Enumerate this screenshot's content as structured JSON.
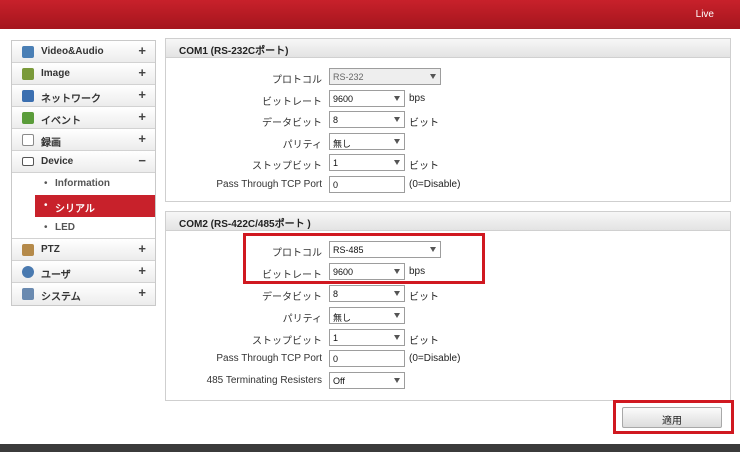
{
  "header": {
    "status_label": "Live"
  },
  "sidebar": {
    "items": [
      {
        "label": "Video&Audio",
        "toggle": "+",
        "icon": "video-audio-icon",
        "color": "#4a7fb5"
      },
      {
        "label": "Image",
        "toggle": "+",
        "icon": "image-icon",
        "color": "#7a9a3a"
      },
      {
        "label": "ネットワーク",
        "toggle": "+",
        "icon": "network-icon",
        "color": "#3b6fb0"
      },
      {
        "label": "イベント",
        "toggle": "+",
        "icon": "event-icon",
        "color": "#5a9c3a"
      },
      {
        "label": "録画",
        "toggle": "+",
        "icon": "recording-icon",
        "color": "#8a8a8a"
      },
      {
        "label": "Device",
        "toggle": "−",
        "icon": "device-icon",
        "color": "#555555"
      },
      {
        "label": "PTZ",
        "toggle": "+",
        "icon": "ptz-icon",
        "color": "#b58a4a"
      },
      {
        "label": "ユーザ",
        "toggle": "+",
        "icon": "user-icon",
        "color": "#4a7ab0"
      },
      {
        "label": "システム",
        "toggle": "+",
        "icon": "system-icon",
        "color": "#6a8ab0"
      }
    ],
    "device_sub": [
      {
        "label": "Information",
        "bullet": "•"
      },
      {
        "label": "シリアル",
        "bullet": "•"
      },
      {
        "label": "LED",
        "bullet": "•"
      }
    ]
  },
  "com1": {
    "title": "COM1 (RS-232Cポート)",
    "protocol": {
      "label": "プロトコル",
      "value": "RS-232"
    },
    "bitrate": {
      "label": "ビットレート",
      "value": "9600",
      "unit": "bps"
    },
    "databits": {
      "label": "データビット",
      "value": "8",
      "unit": "ビット"
    },
    "parity": {
      "label": "パリティ",
      "value": "無し"
    },
    "stopbits": {
      "label": "ストップビット",
      "value": "1",
      "unit": "ビット"
    },
    "tcp_port": {
      "label": "Pass Through TCP Port",
      "value": "0",
      "unit": "(0=Disable)"
    }
  },
  "com2": {
    "title": "COM2 (RS-422C/485ポート )",
    "protocol": {
      "label": "プロトコル",
      "value": "RS-485"
    },
    "bitrate": {
      "label": "ビットレート",
      "value": "9600",
      "unit": "bps"
    },
    "databits": {
      "label": "データビット",
      "value": "8",
      "unit": "ビット"
    },
    "parity": {
      "label": "パリティ",
      "value": "無し"
    },
    "stopbits": {
      "label": "ストップビット",
      "value": "1",
      "unit": "ビット"
    },
    "tcp_port": {
      "label": "Pass Through TCP Port",
      "value": "0",
      "unit": "(0=Disable)"
    },
    "terminating": {
      "label": "485 Terminating Resisters",
      "value": "Off"
    }
  },
  "actions": {
    "apply_label": "適用"
  },
  "colors": {
    "brand_red": "#c8212b",
    "highlight_red": "#d01820"
  }
}
